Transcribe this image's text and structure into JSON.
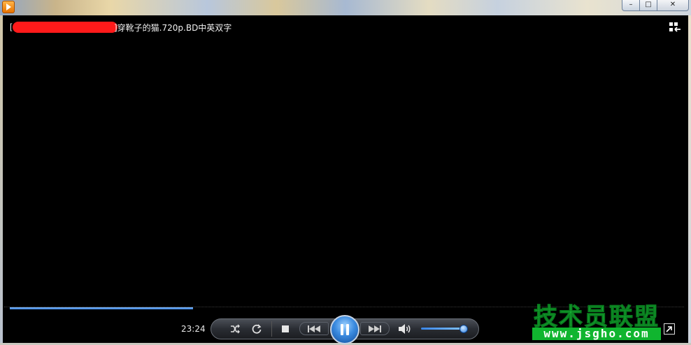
{
  "window": {
    "minimize_glyph": "–",
    "maximize_glyph": "□",
    "close_glyph": "✕"
  },
  "video": {
    "title_prefix": "[",
    "title": "]穿靴子的猫.720p.BD中英双字"
  },
  "playback": {
    "time": "23:24",
    "progress": 0.27,
    "volume": 0.93,
    "state": "playing"
  },
  "controls": {
    "shuffle_icon": "shuffle-icon",
    "repeat_icon": "repeat-icon",
    "stop_icon": "stop-icon",
    "previous_icon": "previous-icon",
    "pause_icon": "pause-icon",
    "next_icon": "next-icon",
    "volume_icon": "speaker-icon",
    "switch_icon": "switch-to-library-icon"
  },
  "watermark": {
    "name": "技术员联盟",
    "url": "www.jsgho.com"
  },
  "colors": {
    "accent": "#2e78d8",
    "watermark_green": "#19c23a",
    "redaction": "#ff1a1a"
  }
}
